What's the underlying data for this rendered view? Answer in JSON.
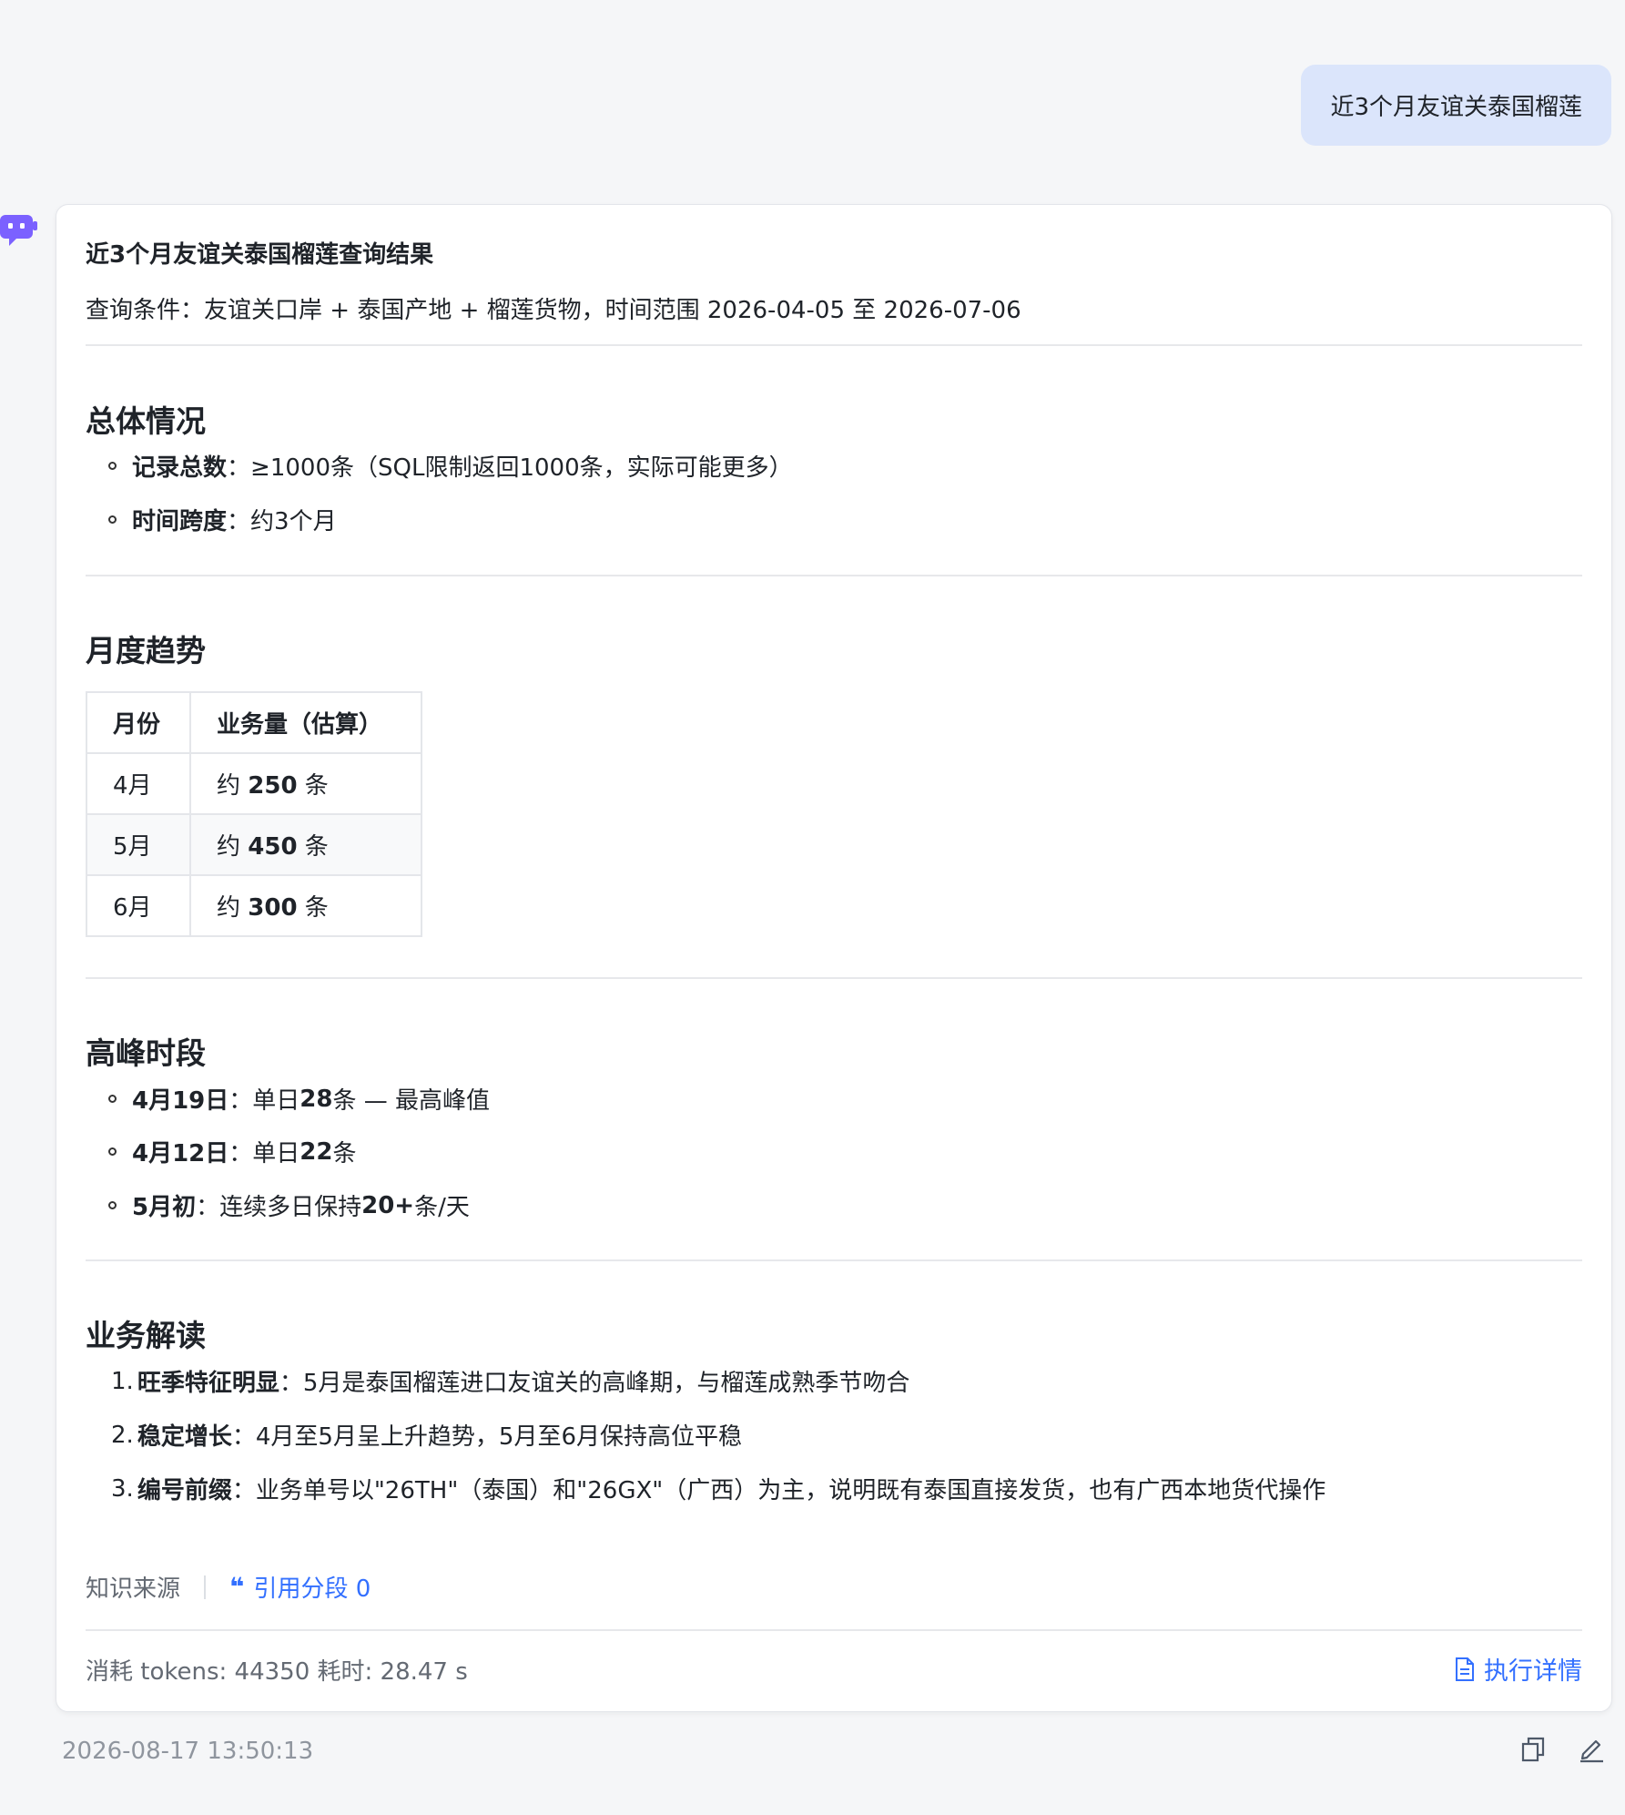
{
  "user_message": "近3个月友谊关泰国榴莲",
  "answer": {
    "title": "近3个月友谊关泰国榴莲查询结果",
    "subtitle": "查询条件：友谊关口岸 + 泰国产地 + 榴莲货物，时间范围 2026-04-05 至 2026-07-06",
    "overview": {
      "heading": "总体情况",
      "items": [
        {
          "label": "记录总数",
          "sep": "：",
          "text": "≥1000条（SQL限制返回1000条，实际可能更多）"
        },
        {
          "label": "时间跨度",
          "sep": "：",
          "text": "约3个月"
        }
      ]
    },
    "trend": {
      "heading": "月度趋势",
      "headers": [
        "月份",
        "业务量（估算）"
      ],
      "rows": [
        {
          "month": "4月",
          "pre": "约 ",
          "value": "250",
          "post": " 条"
        },
        {
          "month": "5月",
          "pre": "约 ",
          "value": "450",
          "post": " 条"
        },
        {
          "month": "6月",
          "pre": "约 ",
          "value": "300",
          "post": " 条"
        }
      ]
    },
    "peak": {
      "heading": "高峰时段",
      "items": [
        {
          "label": "4月19日",
          "pre": "：单日 ",
          "value": "28",
          "post": " 条 — 最高峰值"
        },
        {
          "label": "4月12日",
          "pre": "：单日 ",
          "value": "22",
          "post": " 条"
        },
        {
          "label": "5月初",
          "pre": "：连续多日保持 ",
          "value": "20+",
          "post": " 条/天"
        }
      ]
    },
    "analysis": {
      "heading": "业务解读",
      "items": [
        {
          "num": "1.",
          "label": "旺季特征明显",
          "sep": "：",
          "text": "5月是泰国榴莲进口友谊关的高峰期，与榴莲成熟季节吻合"
        },
        {
          "num": "2.",
          "label": "稳定增长",
          "sep": "：",
          "text": "4月至5月呈上升趋势，5月至6月保持高位平稳"
        },
        {
          "num": "3.",
          "label": "编号前缀",
          "sep": "：",
          "text": "业务单号以\"26TH\"（泰国）和\"26GX\"（广西）为主，说明既有泰国直接发货，也有广西本地货代操作"
        }
      ]
    },
    "source_label": "知识来源",
    "cite_label": "引用分段 0",
    "stats": "消耗 tokens: 44350  耗时: 28.47 s",
    "detail_label": "执行详情"
  },
  "timestamp": "2026-08-17 13:50:13",
  "colors": {
    "accent": "#3370ff",
    "user_bubble": "#dbe5fb",
    "avatar": "#7b61ff"
  }
}
